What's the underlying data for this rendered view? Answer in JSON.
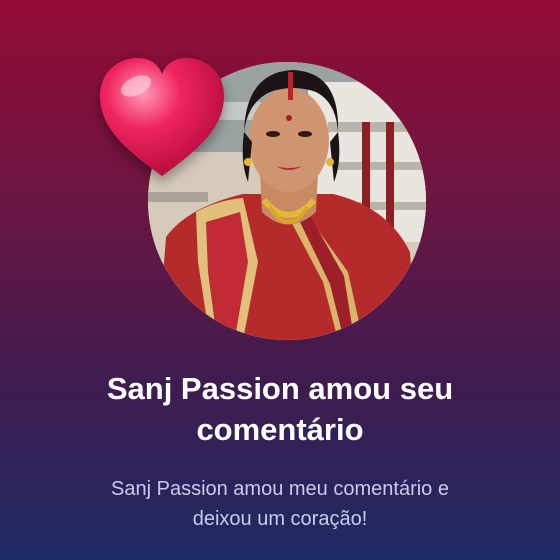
{
  "notification": {
    "title_line1": "Sanj Passion amou seu",
    "title_line2": "comentário",
    "message_line1": "Sanj Passion amou meu comentário e",
    "message_line2": "deixou um coração!"
  },
  "icons": {
    "reaction": "heart-icon",
    "profile": "avatar"
  },
  "colors": {
    "gradient_top": "#930b35",
    "gradient_bottom": "#1c2a63",
    "heart": "#f0245e",
    "title_text": "#ffffff",
    "message_text": "#c7cce8"
  }
}
